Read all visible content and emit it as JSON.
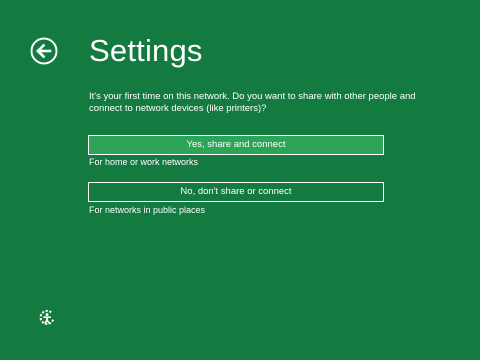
{
  "header": {
    "back_icon": "back-arrow-circle-icon",
    "title": "Settings"
  },
  "main": {
    "prompt": "It's your first time on this network. Do you want to share with other people and connect to network devices (like printers)?",
    "options": [
      {
        "label": "Yes, share and connect",
        "caption": "For home or work networks",
        "selected": true
      },
      {
        "label": "No, don't share or connect",
        "caption": "For networks in public places",
        "selected": false
      }
    ]
  },
  "footer": {
    "ease_of_access_icon": "ease-of-access-icon"
  },
  "colors": {
    "background": "#137a40",
    "selected_button": "#2ca559",
    "text": "#ffffff"
  }
}
